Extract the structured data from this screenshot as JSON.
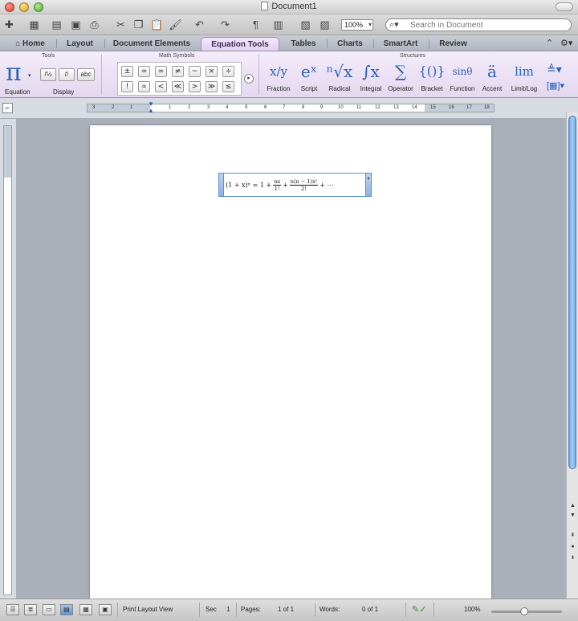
{
  "window": {
    "title": "Document1"
  },
  "toolbar": {
    "zoom": "100%",
    "search_placeholder": "Search in Document"
  },
  "tabs": [
    "Home",
    "Layout",
    "Document Elements",
    "Equation Tools",
    "Tables",
    "Charts",
    "SmartArt",
    "Review"
  ],
  "active_tab": "Equation Tools",
  "ribbon": {
    "groups": {
      "tools": "Tools",
      "math_symbols": "Math Symbols",
      "structures": "Structures"
    },
    "equation_label": "Equation",
    "display_label": "Display",
    "display_buttons": [
      "abc"
    ],
    "symbols_row1": [
      "±",
      "∞",
      "=",
      "≠",
      "~",
      "×",
      "÷"
    ],
    "symbols_row2": [
      "!",
      "∝",
      "<",
      "≪",
      ">",
      "≫",
      "≤"
    ],
    "structures": [
      {
        "label": "Fraction",
        "glyph": "x/y"
      },
      {
        "label": "Script",
        "glyph": "eˣ"
      },
      {
        "label": "Radical",
        "glyph": "ⁿ√x"
      },
      {
        "label": "Integral",
        "glyph": "∫x"
      },
      {
        "label": "Operator",
        "glyph": "∑"
      },
      {
        "label": "Bracket",
        "glyph": "{()}"
      },
      {
        "label": "Function",
        "glyph": "sinθ"
      },
      {
        "label": "Accent",
        "glyph": "ä"
      },
      {
        "label": "Limit/Log",
        "glyph": "lim"
      }
    ]
  },
  "ruler": {
    "numbers": [
      "3",
      "2",
      "1",
      "1",
      "2",
      "3",
      "4",
      "5",
      "6",
      "7",
      "8",
      "9",
      "10",
      "11",
      "12",
      "13",
      "14",
      "15",
      "16",
      "17",
      "18"
    ]
  },
  "equation": {
    "lhs": "(1 + x)ⁿ = 1 +",
    "frac1_num": "nx",
    "frac1_den": "1!",
    "plus": "+",
    "frac2_num": "n(n − 1)x²",
    "frac2_den": "2!",
    "tail": "+ ⋯"
  },
  "status": {
    "view": "Print Layout View",
    "sec_label": "Sec",
    "sec": "1",
    "pages_label": "Pages:",
    "pages": "1 of 1",
    "words_label": "Words:",
    "words": "0 of 1",
    "zoom": "100%"
  },
  "colors": {
    "ribbon_accent": "#e4d7ef",
    "icon_blue": "#2b63b6",
    "scroll_thumb": "#6fa3e0"
  }
}
